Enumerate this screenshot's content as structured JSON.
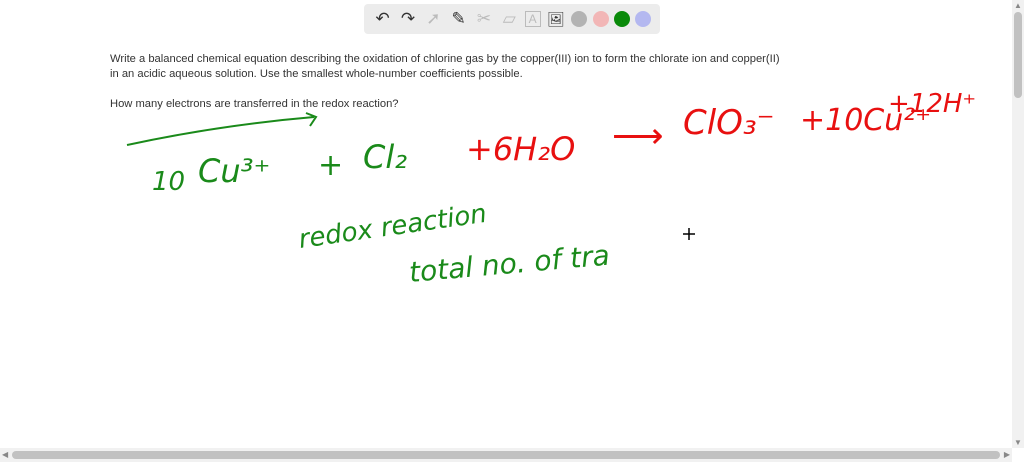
{
  "toolbar": {
    "tools": [
      "undo-icon",
      "redo-icon",
      "select-icon",
      "pen-icon",
      "tools-icon",
      "eraser-icon",
      "text-icon",
      "image-icon"
    ],
    "colors": [
      "#b3b3b3",
      "#f2b6b6",
      "#0a8a0a",
      "#b4b8f0"
    ]
  },
  "question": {
    "paragraph1": "Write a balanced chemical equation describing the oxidation of chlorine gas by the copper(III) ion to form the chlorate ion and copper(II) in an acidic aqueous solution. Use the smallest whole-number coefficients possible.",
    "paragraph2": "How many electrons are transferred in the redox reaction?"
  },
  "handwriting": {
    "reactant_coeff": "10",
    "reactant1": "Cu³⁺",
    "plus1": "+",
    "reactant2": "Cl₂",
    "reactant3": "+6H₂O",
    "arrow": "⟶",
    "product1": "ClO₃⁻",
    "product2": "+10Cu²⁺",
    "product3": "+12H⁺",
    "note1": "redox reaction",
    "note2": "total no. of tra"
  },
  "ink_colors": {
    "green": "#1a8a1a",
    "red": "#e81010"
  }
}
